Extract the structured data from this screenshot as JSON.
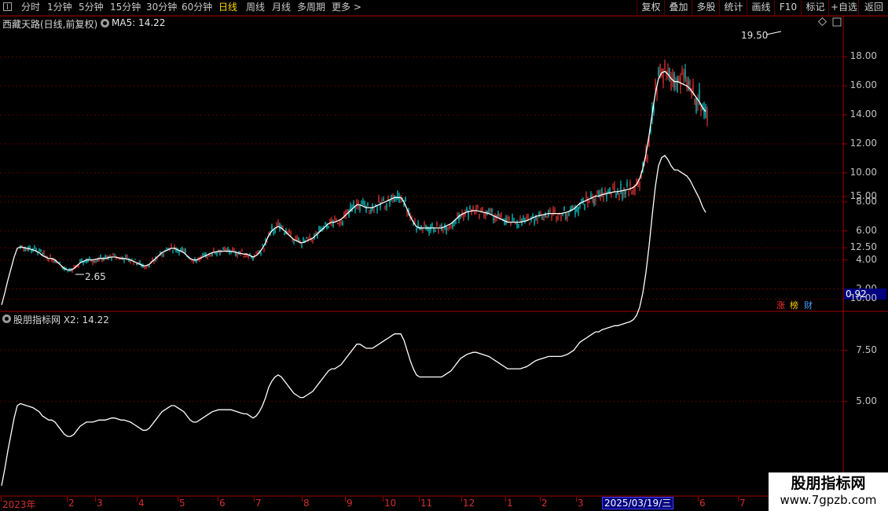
{
  "toolbar": {
    "periods": [
      "分时",
      "1分钟",
      "5分钟",
      "15分钟",
      "30分钟",
      "60分钟",
      "日线",
      "周线",
      "月线",
      "多周期",
      "更多 >"
    ],
    "active": "日线",
    "right_buttons": [
      "复权",
      "叠加",
      "多股",
      "统计",
      "画线",
      "F10",
      "标记",
      "+自选",
      "返回"
    ]
  },
  "main": {
    "title": "西藏天路(日线,前复权)",
    "ma_label": "MA5: 14.22",
    "price_axis": [
      "18.00",
      "16.00",
      "14.00",
      "12.00",
      "10.00",
      "8.00",
      "6.00",
      "4.00",
      "2.00"
    ],
    "high_label": "19.50",
    "low_label": "2.65",
    "current_box": "0.92",
    "tags": [
      {
        "text": "涨",
        "color": "#ff3030"
      },
      {
        "text": "榜",
        "color": "#ffcc00"
      },
      {
        "text": "财",
        "color": "#4aa0ff"
      }
    ]
  },
  "sub": {
    "title": "股朋指标网 X2: 14.22",
    "axis": [
      "15.00",
      "12.50",
      "10.00",
      "7.50",
      "5.00"
    ]
  },
  "time_axis": {
    "labels": [
      "2023年",
      "2",
      "3",
      "4",
      "5",
      "6",
      "7",
      "8",
      "9",
      "10",
      "11",
      "12",
      "1",
      "2",
      "3",
      "5",
      "6",
      "7"
    ],
    "selected_date": "2025/03/19/三"
  },
  "watermark": {
    "name": "股朋指标网",
    "url": "www.7gpzb.com"
  },
  "colors": {
    "up": "#ff3b3b",
    "down": "#00e5e5",
    "ma": "#ffffff",
    "grid": "#5a0000",
    "border": "#a00000"
  },
  "chart_data": {
    "type": "line",
    "x": [
      0,
      2,
      4,
      6,
      8,
      10,
      12,
      14,
      16,
      18,
      20,
      22,
      24,
      26,
      28,
      30,
      32,
      34,
      36,
      38,
      40,
      42,
      44,
      46,
      48,
      50,
      52,
      54,
      56,
      58,
      60,
      62,
      64,
      66,
      68,
      70,
      72,
      74,
      76,
      78,
      80,
      82,
      84,
      86,
      88,
      90,
      92,
      94,
      96,
      98,
      100,
      102,
      104,
      106,
      108,
      110,
      112,
      114,
      116,
      118,
      120,
      122,
      124,
      126,
      128,
      130,
      132,
      134,
      136,
      138,
      140,
      142,
      144,
      146,
      148,
      150,
      152,
      154,
      156,
      158,
      160,
      162,
      164,
      166,
      168,
      170,
      172,
      174,
      176,
      178,
      180,
      182,
      184,
      186,
      188,
      190,
      192,
      194,
      196,
      198,
      200,
      202,
      204,
      206,
      208,
      210,
      212,
      214,
      216,
      218,
      220,
      222,
      224,
      226,
      228,
      230,
      232,
      234,
      236,
      238,
      240,
      242,
      244,
      246,
      248,
      250,
      252,
      254,
      256,
      258,
      260,
      262,
      264,
      266,
      268,
      270,
      272,
      274,
      276,
      278,
      280,
      282,
      284,
      286,
      288,
      290,
      292,
      294,
      296,
      298,
      300,
      302,
      304,
      306,
      308,
      310,
      312,
      314,
      316,
      318,
      320,
      322,
      324,
      326,
      328,
      330,
      332,
      334,
      336,
      338,
      340,
      342,
      344,
      346,
      348,
      350,
      352,
      354,
      356,
      358,
      360,
      362,
      364,
      366,
      368,
      370,
      372,
      374,
      376,
      378,
      380,
      382,
      384,
      386,
      388,
      390,
      392,
      394,
      396,
      398,
      400,
      402,
      404,
      406,
      408,
      410,
      412,
      414,
      416,
      418,
      420,
      422,
      424,
      426,
      428,
      430,
      432,
      434,
      436,
      438,
      440,
      442,
      444,
      446,
      448,
      450,
      452,
      454,
      456,
      458,
      460,
      462,
      464,
      466,
      468,
      470,
      472,
      474,
      476,
      478,
      480,
      482,
      484,
      486,
      488,
      490,
      492,
      494,
      496,
      498,
      500,
      502,
      504,
      506,
      508,
      510,
      512,
      514,
      516,
      518,
      520,
      522,
      524,
      526,
      528,
      530,
      532
    ],
    "series": [
      {
        "values": [
          0.9,
          1.7,
          2.6,
          3.4,
          4.2,
          4.8,
          4.9,
          4.85,
          4.8,
          4.75,
          4.7,
          4.6,
          4.5,
          4.3,
          4.2,
          4.1,
          4.1,
          4.0,
          3.8,
          3.6,
          3.4,
          3.3,
          3.3,
          3.4,
          3.6,
          3.8,
          3.9,
          4.0,
          4.0,
          4.0,
          4.05,
          4.1,
          4.1,
          4.1,
          4.15,
          4.2,
          4.2,
          4.15,
          4.1,
          4.1,
          4.05,
          4.0,
          3.9,
          3.8,
          3.7,
          3.6,
          3.6,
          3.7,
          3.9,
          4.1,
          4.3,
          4.5,
          4.6,
          4.7,
          4.8,
          4.8,
          4.7,
          4.6,
          4.5,
          4.3,
          4.1,
          4.0,
          4.0,
          4.1,
          4.2,
          4.3,
          4.4,
          4.5,
          4.55,
          4.6,
          4.6,
          4.6,
          4.6,
          4.6,
          4.55,
          4.5,
          4.45,
          4.4,
          4.4,
          4.3,
          4.2,
          4.3,
          4.5,
          4.8,
          5.2,
          5.7,
          6.0,
          6.2,
          6.3,
          6.2,
          6.0,
          5.8,
          5.6,
          5.4,
          5.3,
          5.2,
          5.2,
          5.3,
          5.4,
          5.5,
          5.7,
          5.9,
          6.1,
          6.3,
          6.5,
          6.6,
          6.6,
          6.7,
          6.8,
          7.0,
          7.2,
          7.4,
          7.6,
          7.8,
          7.8,
          7.7,
          7.6,
          7.6,
          7.6,
          7.7,
          7.8,
          7.9,
          8.0,
          8.1,
          8.2,
          8.3,
          8.3,
          8.3,
          8.0,
          7.5,
          7.0,
          6.6,
          6.3,
          6.2,
          6.2,
          6.2,
          6.2,
          6.2,
          6.2,
          6.2,
          6.2,
          6.3,
          6.4,
          6.5,
          6.7,
          6.9,
          7.1,
          7.2,
          7.3,
          7.35,
          7.4,
          7.4,
          7.35,
          7.3,
          7.25,
          7.2,
          7.1,
          7.0,
          6.9,
          6.8,
          6.7,
          6.6,
          6.6,
          6.6,
          6.6,
          6.6,
          6.65,
          6.7,
          6.8,
          6.9,
          7.0,
          7.05,
          7.1,
          7.15,
          7.2,
          7.2,
          7.2,
          7.2,
          7.2,
          7.25,
          7.3,
          7.4,
          7.5,
          7.7,
          7.9,
          8.0,
          8.1,
          8.2,
          8.3,
          8.4,
          8.4,
          8.5,
          8.55,
          8.6,
          8.65,
          8.7,
          8.7,
          8.75,
          8.8,
          8.85,
          8.9,
          9.0,
          9.2,
          9.6,
          10.3,
          11.3,
          12.6,
          14.1,
          15.5,
          16.5,
          16.9,
          17.0,
          16.8,
          16.5,
          16.3,
          16.3,
          16.2,
          16.1,
          16.0,
          15.8,
          15.5,
          15.2,
          14.9,
          14.5,
          14.22
        ],
        "color": "#ffffff"
      }
    ],
    "price_range": [
      1.0,
      20.0
    ],
    "sub_range": [
      3.0,
      18.5
    ],
    "xlabel": "",
    "ylabel": ""
  }
}
